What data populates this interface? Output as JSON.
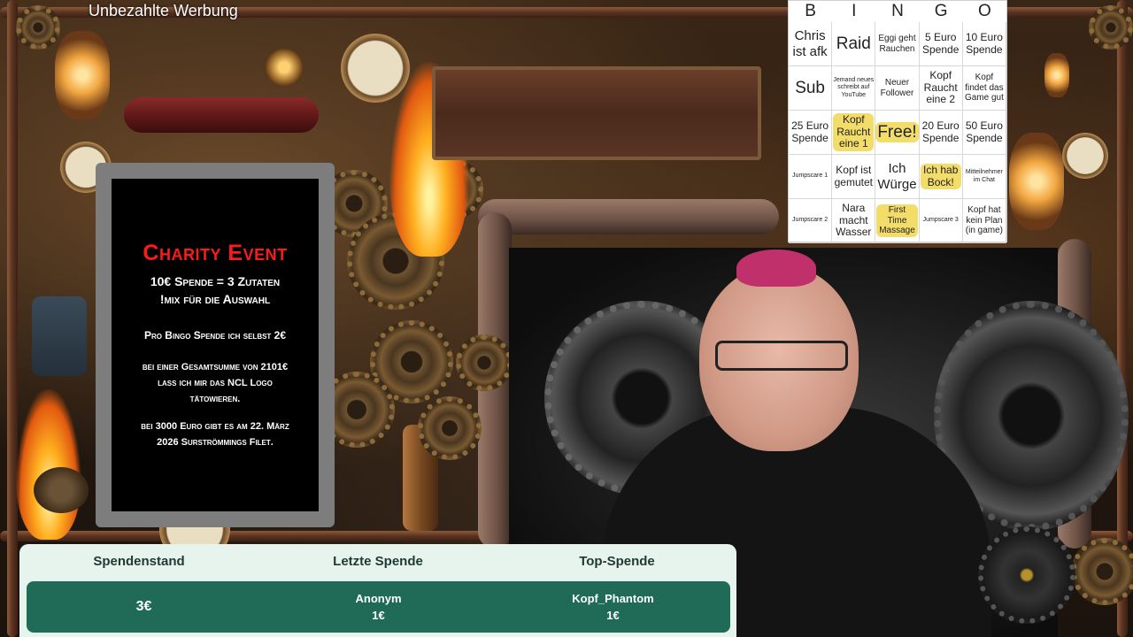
{
  "watermark": "Unbezahlte Werbung",
  "charity": {
    "title": "Charity Event",
    "line1": "10€ Spende = 3 Zutaten",
    "line2": "!mix für die Auswahl",
    "line3": "Pro Bingo Spende ich selbst 2€",
    "line4a": "bei einer Gesamtsumme von 2101€",
    "line4b": "lass ich mir das NCL Logo",
    "line4c": "tätowieren.",
    "line5a": "bei 3000 Euro gibt es am 22. März",
    "line5b": "2026 Surströmmings Filet."
  },
  "bingo": {
    "letters": [
      "B",
      "I",
      "N",
      "G",
      "O"
    ],
    "cells": [
      {
        "text": "Chris ist afk",
        "marked": false
      },
      {
        "text": "Raid",
        "marked": false
      },
      {
        "text": "Eggi geht Rauchen",
        "marked": false
      },
      {
        "text": "5 Euro Spende",
        "marked": false
      },
      {
        "text": "10 Euro Spende",
        "marked": false
      },
      {
        "text": "Sub",
        "marked": false
      },
      {
        "text": "Jemand neues schreibt auf YouTube",
        "marked": false
      },
      {
        "text": "Neuer Follower",
        "marked": false
      },
      {
        "text": "Kopf Raucht eine 2",
        "marked": false
      },
      {
        "text": "Kopf findet das Game gut",
        "marked": false
      },
      {
        "text": "25 Euro Spende",
        "marked": false
      },
      {
        "text": "Kopf Raucht eine 1",
        "marked": true
      },
      {
        "text": "Free!",
        "marked": true
      },
      {
        "text": "20 Euro Spende",
        "marked": false
      },
      {
        "text": "50 Euro Spende",
        "marked": false
      },
      {
        "text": "Jumpscare 1",
        "marked": false
      },
      {
        "text": "Kopf ist gemutet",
        "marked": false
      },
      {
        "text": "Ich Würge",
        "marked": false
      },
      {
        "text": "Ich hab Bock!",
        "marked": true
      },
      {
        "text": "Mitteilnehmer im Chat",
        "marked": false
      },
      {
        "text": "Jumpscare 2",
        "marked": false
      },
      {
        "text": "Nara macht Wasser",
        "marked": false
      },
      {
        "text": "First Time Massage",
        "marked": true
      },
      {
        "text": "Jumpscare 3",
        "marked": false
      },
      {
        "text": "Kopf hat kein Plan (in game)",
        "marked": false
      }
    ]
  },
  "donations": {
    "header_total": "Spendenstand",
    "header_last": "Letzte Spende",
    "header_top": "Top-Spende",
    "total_value": "3€",
    "last_name": "Anonym",
    "last_amount": "1€",
    "top_name": "Kopf_Phantom",
    "top_amount": "1€"
  },
  "colors": {
    "event_title": "#ff1a1a",
    "bingo_mark": "#f2dc6a",
    "donation_bar": "#1f6b57"
  }
}
